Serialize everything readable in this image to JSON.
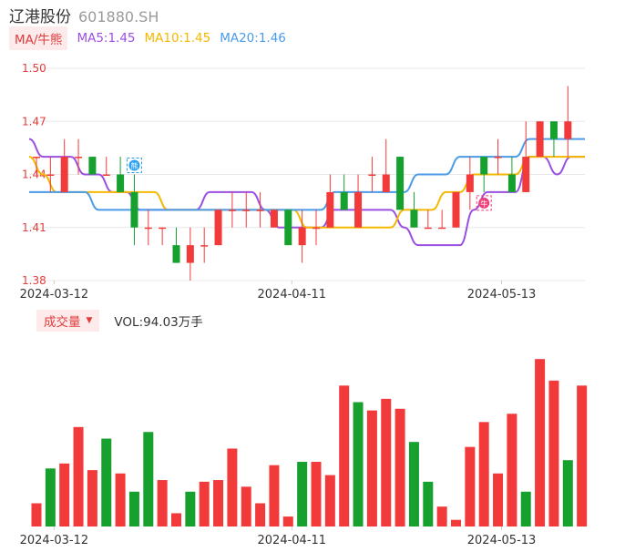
{
  "header": {
    "name": "辽港股份",
    "code": "601880.SH"
  },
  "legend": {
    "tag": "MA/牛熊",
    "items": [
      {
        "label": "MA5:1.45",
        "color": "#9b4fe0"
      },
      {
        "label": "MA10:1.45",
        "color": "#f5b800"
      },
      {
        "label": "MA20:1.46",
        "color": "#4a9be8"
      }
    ]
  },
  "volume_legend": {
    "tag": "成交量",
    "value": "VOL:94.03万手"
  },
  "colors": {
    "up": "#f23a3a",
    "down": "#16a02e",
    "grid": "#e8e8e8",
    "axis_text": "#333333",
    "price_label": "#e03c3c"
  },
  "chart_data": [
    {
      "type": "candlestick",
      "ylim": [
        1.38,
        1.5
      ],
      "yticks": [
        "1.50",
        "1.47",
        "1.44",
        "1.41",
        "1.38"
      ],
      "xticks": [
        {
          "index": 1,
          "label": "2024-03-12"
        },
        {
          "index": 18,
          "label": "2024-04-11"
        },
        {
          "index": 33,
          "label": "2024-05-13"
        }
      ],
      "markers": [
        {
          "index": 7,
          "label": "熊",
          "color": "#2aa0f0"
        },
        {
          "index": 32,
          "label": "牛",
          "color": "#f0407a"
        }
      ],
      "candles": [
        {
          "o": 1.45,
          "h": 1.45,
          "l": 1.44,
          "c": 1.45,
          "dir": "up"
        },
        {
          "o": 1.44,
          "h": 1.45,
          "l": 1.43,
          "c": 1.44,
          "dir": "up"
        },
        {
          "o": 1.43,
          "h": 1.46,
          "l": 1.43,
          "c": 1.45,
          "dir": "up"
        },
        {
          "o": 1.45,
          "h": 1.46,
          "l": 1.44,
          "c": 1.45,
          "dir": "up"
        },
        {
          "o": 1.45,
          "h": 1.45,
          "l": 1.44,
          "c": 1.44,
          "dir": "down"
        },
        {
          "o": 1.44,
          "h": 1.45,
          "l": 1.44,
          "c": 1.44,
          "dir": "up"
        },
        {
          "o": 1.44,
          "h": 1.45,
          "l": 1.43,
          "c": 1.43,
          "dir": "down"
        },
        {
          "o": 1.43,
          "h": 1.44,
          "l": 1.4,
          "c": 1.41,
          "dir": "down"
        },
        {
          "o": 1.41,
          "h": 1.42,
          "l": 1.4,
          "c": 1.41,
          "dir": "up"
        },
        {
          "o": 1.41,
          "h": 1.41,
          "l": 1.4,
          "c": 1.41,
          "dir": "up"
        },
        {
          "o": 1.4,
          "h": 1.41,
          "l": 1.39,
          "c": 1.39,
          "dir": "down"
        },
        {
          "o": 1.39,
          "h": 1.41,
          "l": 1.38,
          "c": 1.4,
          "dir": "up"
        },
        {
          "o": 1.4,
          "h": 1.41,
          "l": 1.39,
          "c": 1.4,
          "dir": "up"
        },
        {
          "o": 1.4,
          "h": 1.42,
          "l": 1.4,
          "c": 1.42,
          "dir": "up"
        },
        {
          "o": 1.42,
          "h": 1.43,
          "l": 1.41,
          "c": 1.42,
          "dir": "up"
        },
        {
          "o": 1.42,
          "h": 1.43,
          "l": 1.41,
          "c": 1.42,
          "dir": "up"
        },
        {
          "o": 1.42,
          "h": 1.43,
          "l": 1.41,
          "c": 1.42,
          "dir": "up"
        },
        {
          "o": 1.41,
          "h": 1.42,
          "l": 1.41,
          "c": 1.42,
          "dir": "up"
        },
        {
          "o": 1.42,
          "h": 1.42,
          "l": 1.4,
          "c": 1.4,
          "dir": "down"
        },
        {
          "o": 1.4,
          "h": 1.42,
          "l": 1.39,
          "c": 1.41,
          "dir": "up"
        },
        {
          "o": 1.41,
          "h": 1.42,
          "l": 1.4,
          "c": 1.41,
          "dir": "up"
        },
        {
          "o": 1.41,
          "h": 1.44,
          "l": 1.41,
          "c": 1.43,
          "dir": "up"
        },
        {
          "o": 1.43,
          "h": 1.44,
          "l": 1.42,
          "c": 1.42,
          "dir": "down"
        },
        {
          "o": 1.41,
          "h": 1.44,
          "l": 1.41,
          "c": 1.43,
          "dir": "up"
        },
        {
          "o": 1.44,
          "h": 1.45,
          "l": 1.43,
          "c": 1.44,
          "dir": "up"
        },
        {
          "o": 1.43,
          "h": 1.46,
          "l": 1.43,
          "c": 1.44,
          "dir": "up"
        },
        {
          "o": 1.45,
          "h": 1.45,
          "l": 1.42,
          "c": 1.42,
          "dir": "down"
        },
        {
          "o": 1.42,
          "h": 1.43,
          "l": 1.41,
          "c": 1.41,
          "dir": "down"
        },
        {
          "o": 1.41,
          "h": 1.42,
          "l": 1.41,
          "c": 1.41,
          "dir": "up"
        },
        {
          "o": 1.41,
          "h": 1.42,
          "l": 1.41,
          "c": 1.41,
          "dir": "up"
        },
        {
          "o": 1.41,
          "h": 1.43,
          "l": 1.41,
          "c": 1.43,
          "dir": "up"
        },
        {
          "o": 1.43,
          "h": 1.45,
          "l": 1.42,
          "c": 1.44,
          "dir": "up"
        },
        {
          "o": 1.44,
          "h": 1.45,
          "l": 1.43,
          "c": 1.45,
          "dir": "down"
        },
        {
          "o": 1.45,
          "h": 1.46,
          "l": 1.44,
          "c": 1.45,
          "dir": "up"
        },
        {
          "o": 1.44,
          "h": 1.45,
          "l": 1.43,
          "c": 1.43,
          "dir": "down"
        },
        {
          "o": 1.43,
          "h": 1.47,
          "l": 1.43,
          "c": 1.45,
          "dir": "up"
        },
        {
          "o": 1.45,
          "h": 1.47,
          "l": 1.45,
          "c": 1.47,
          "dir": "up"
        },
        {
          "o": 1.47,
          "h": 1.47,
          "l": 1.45,
          "c": 1.46,
          "dir": "down"
        },
        {
          "o": 1.46,
          "h": 1.49,
          "l": 1.45,
          "c": 1.47,
          "dir": "up"
        }
      ],
      "series": [
        {
          "name": "MA5",
          "color": "#9b4fe0",
          "values": [
            1.46,
            1.45,
            1.45,
            1.45,
            1.44,
            1.44,
            1.43,
            1.43,
            1.42,
            1.42,
            1.42,
            1.42,
            1.42,
            1.43,
            1.43,
            1.43,
            1.43,
            1.42,
            1.41,
            1.41,
            1.41,
            1.41,
            1.42,
            1.42,
            1.42,
            1.42,
            1.42,
            1.41,
            1.4,
            1.4,
            1.4,
            1.4,
            1.42,
            1.43,
            1.43,
            1.43,
            1.45,
            1.45,
            1.44,
            1.45,
            1.45
          ]
        },
        {
          "name": "MA10",
          "color": "#f5b800",
          "values": [
            1.45,
            1.44,
            1.43,
            1.43,
            1.43,
            1.43,
            1.43,
            1.43,
            1.43,
            1.43,
            1.42,
            1.42,
            1.42,
            1.42,
            1.42,
            1.42,
            1.42,
            1.42,
            1.42,
            1.42,
            1.41,
            1.41,
            1.41,
            1.41,
            1.41,
            1.41,
            1.41,
            1.42,
            1.42,
            1.42,
            1.43,
            1.43,
            1.44,
            1.44,
            1.44,
            1.44,
            1.45,
            1.45,
            1.45,
            1.45,
            1.45
          ]
        },
        {
          "name": "MA20",
          "color": "#4a9be8",
          "values": [
            1.43,
            1.43,
            1.43,
            1.43,
            1.43,
            1.42,
            1.42,
            1.42,
            1.42,
            1.42,
            1.42,
            1.42,
            1.42,
            1.42,
            1.42,
            1.42,
            1.42,
            1.42,
            1.42,
            1.42,
            1.42,
            1.42,
            1.43,
            1.43,
            1.43,
            1.43,
            1.43,
            1.43,
            1.44,
            1.44,
            1.44,
            1.45,
            1.45,
            1.45,
            1.45,
            1.45,
            1.46,
            1.46,
            1.46,
            1.46,
            1.46
          ]
        }
      ]
    },
    {
      "type": "bar",
      "name": "成交量",
      "xticks": [
        {
          "index": 1,
          "label": "2024-03-12"
        },
        {
          "index": 18,
          "label": "2024-04-11"
        },
        {
          "index": 33,
          "label": "2024-05-13"
        }
      ],
      "ylim": [
        0,
        100
      ],
      "values": [
        14,
        35,
        38,
        60,
        34,
        53,
        32,
        21,
        57,
        28,
        8,
        21,
        27,
        28,
        47,
        24,
        14,
        37,
        6,
        39,
        39,
        31,
        85,
        75,
        70,
        77,
        71,
        51,
        27,
        12,
        4,
        48,
        63,
        32,
        68,
        21,
        101,
        88,
        40,
        85
      ],
      "directions": [
        "up",
        "down",
        "up",
        "up",
        "up",
        "down",
        "up",
        "down",
        "down",
        "up",
        "up",
        "down",
        "up",
        "up",
        "up",
        "up",
        "up",
        "up",
        "up",
        "down",
        "up",
        "up",
        "up",
        "down",
        "up",
        "up",
        "up",
        "down",
        "down",
        "up",
        "up",
        "up",
        "up",
        "up",
        "up",
        "down",
        "up",
        "up",
        "down",
        "up"
      ]
    }
  ]
}
